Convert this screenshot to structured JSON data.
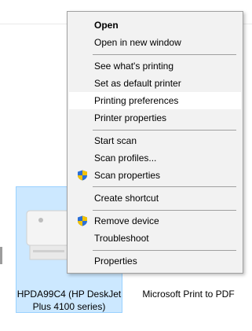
{
  "devices": [
    {
      "label_line1": "HPDA99C4 (HP DeskJet",
      "label_line2": "Plus 4100 series)",
      "selected": true
    },
    {
      "label": "Microsoft Print to PDF"
    }
  ],
  "context_menu": {
    "items": [
      {
        "label": "Open",
        "bold": true
      },
      {
        "label": "Open in new window"
      },
      {
        "label": "See what's printing"
      },
      {
        "label": "Set as default printer"
      },
      {
        "label": "Printing preferences",
        "highlighted": true
      },
      {
        "label": "Printer properties"
      },
      {
        "label": "Start scan"
      },
      {
        "label": "Scan profiles..."
      },
      {
        "label": "Scan properties",
        "icon": "shield-icon"
      },
      {
        "label": "Create shortcut"
      },
      {
        "label": "Remove device",
        "icon": "shield-icon"
      },
      {
        "label": "Troubleshoot"
      },
      {
        "label": "Properties"
      }
    ]
  },
  "colors": {
    "selection_bg": "#cce8ff",
    "selection_border": "#99d1ff",
    "menu_bg": "#f2f2f2",
    "menu_highlight": "#ffffff"
  }
}
